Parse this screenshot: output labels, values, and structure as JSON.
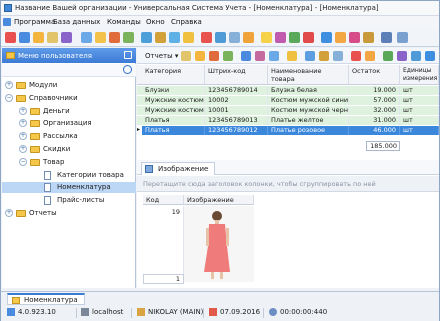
{
  "window": {
    "title": "Название Вашей организации - Универсальная Система Учета - [Номенклатура] - [Номенклатура]"
  },
  "menu": [
    "Программа",
    "База данных",
    "Команды",
    "Окно",
    "Справка"
  ],
  "left_panel": {
    "title": "Меню пользователя",
    "tree": [
      {
        "label": "Модули",
        "level": 0,
        "expander": "+",
        "icon": "folder-icon"
      },
      {
        "label": "Справочники",
        "level": 0,
        "expander": "−",
        "icon": "folder-icon"
      },
      {
        "label": "Деньги",
        "level": 1,
        "expander": "+",
        "icon": "folder-icon"
      },
      {
        "label": "Организация",
        "level": 1,
        "expander": "+",
        "icon": "folder-icon"
      },
      {
        "label": "Рассылка",
        "level": 1,
        "expander": "+",
        "icon": "folder-icon"
      },
      {
        "label": "Скидки",
        "level": 1,
        "expander": "+",
        "icon": "folder-icon"
      },
      {
        "label": "Товар",
        "level": 1,
        "expander": "−",
        "icon": "folder-icon"
      },
      {
        "label": "Категории товара",
        "level": 2,
        "expander": "",
        "icon": "document-icon"
      },
      {
        "label": "Номенклатура",
        "level": 2,
        "expander": "",
        "icon": "document-icon",
        "selected": true
      },
      {
        "label": "Прайс-листы",
        "level": 2,
        "expander": "",
        "icon": "document-icon"
      },
      {
        "label": "Отчеты",
        "level": 0,
        "expander": "+",
        "icon": "folder-icon"
      }
    ]
  },
  "toolbar": {
    "reports_label": "Отчеты ▾"
  },
  "grid": {
    "columns": [
      "Категория",
      "Штрих-код",
      "Наименование товара",
      "Остаток",
      "Единицы измерения"
    ],
    "rows": [
      {
        "category": "Блузки",
        "barcode": "123456789014",
        "name": "Блузка белая",
        "stock": "19.000",
        "unit": "шт"
      },
      {
        "category": "Мужские костюмы",
        "barcode": "10002",
        "name": "Костюм мужской синий",
        "stock": "57.000",
        "unit": "шт"
      },
      {
        "category": "Мужские костюмы",
        "barcode": "10001",
        "name": "Костюм мужской черный",
        "stock": "32.000",
        "unit": "шт"
      },
      {
        "category": "Платья",
        "barcode": "123456789013",
        "name": "Платье желтое",
        "stock": "31.000",
        "unit": "шт"
      },
      {
        "category": "Платья",
        "barcode": "123456789012",
        "name": "Платье розовое",
        "stock": "46.000",
        "unit": "шт",
        "selected": true
      }
    ],
    "total": "185.000"
  },
  "image_panel": {
    "tab": "Изображение",
    "group_hint": "Перетащите сюда заголовок колонки, чтобы сгруппировать по ней",
    "columns": [
      "Код",
      "Изображение"
    ],
    "row": {
      "code": "19"
    },
    "footer_value": "1"
  },
  "bottom_tab": "Номенклатура",
  "status": {
    "version": "4.0.923.10",
    "host": "localhost",
    "user": "NIKOLAY (MAIN)",
    "date": "07.09.2016",
    "time": "00:00:00:440"
  },
  "colors": {
    "accent": "#3a87dc",
    "header": "#4a88e0",
    "stripe": "#dff2df"
  }
}
